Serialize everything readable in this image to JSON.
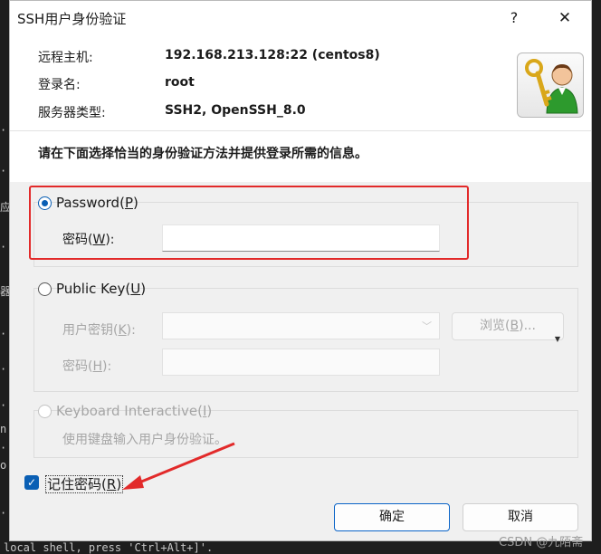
{
  "window": {
    "title": "SSH用户身份验证",
    "help_glyph": "?",
    "close_glyph": "✕"
  },
  "info": {
    "host_label": "远程主机:",
    "host_value": "192.168.213.128:22 (centos8)",
    "login_label": "登录名:",
    "login_value": "root",
    "server_label": "服务器类型:",
    "server_value": "SSH2, OpenSSH_8.0"
  },
  "instruction": "请在下面选择恰当的身份验证方法并提供登录所需的信息。",
  "password_section": {
    "label": "Password",
    "accel": "P",
    "field_label": "密码",
    "field_accel": "W",
    "field_value": ""
  },
  "pubkey_section": {
    "label": "Public Key",
    "accel": "U",
    "key_label": "用户密钥",
    "key_accel": "K",
    "browse_label": "浏览",
    "browse_accel": "B",
    "pass_label": "密码",
    "pass_accel": "H"
  },
  "keyboard_section": {
    "label": "Keyboard Interactive",
    "accel": "I",
    "hint": "使用键盘输入用户身份验证。"
  },
  "remember": {
    "label": "记住密码",
    "accel": "R",
    "checked": true
  },
  "buttons": {
    "ok": "确定",
    "cancel": "取消"
  },
  "terminal": {
    "bottom_text": "local shell, press 'Ctrl+Alt+]'.",
    "edge_chars": [
      "·",
      "·",
      "应",
      "·",
      "器",
      "·",
      "·",
      "·",
      "n",
      "·",
      "o",
      "·"
    ]
  },
  "watermark": "CSDN @九陌斋",
  "colors": {
    "accent": "#0a5fb4",
    "highlight": "#e22a2a"
  }
}
